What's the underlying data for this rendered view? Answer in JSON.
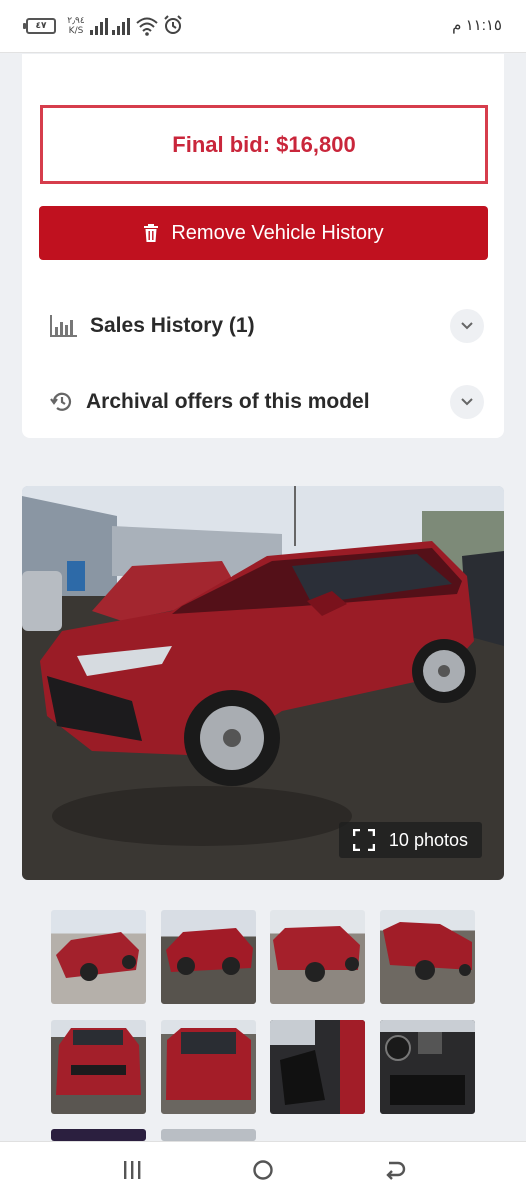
{
  "status_bar": {
    "battery": "٤٧",
    "net_speed_value": "٢٫٩٤",
    "net_speed_unit": "K/S",
    "time": "١١:١٥ م"
  },
  "auction": {
    "final_bid_label": "Final bid: $16,800",
    "remove_history_label": "Remove Vehicle History"
  },
  "sections": {
    "sales_history": "Sales History (1)",
    "archival_offers": "Archival offers of this model"
  },
  "gallery": {
    "photos_count_label": "10 photos",
    "thumbnail_count": 10
  },
  "colors": {
    "accent": "#c0111f",
    "bid_border": "#d63d4c",
    "car_red": "#9a1c26"
  },
  "icons": {
    "remove_button": "trash-icon",
    "sales_history": "bar-chart-icon",
    "archival_offers": "history-icon",
    "expand": "chevron-down-icon",
    "photos_badge": "fullscreen-icon"
  }
}
